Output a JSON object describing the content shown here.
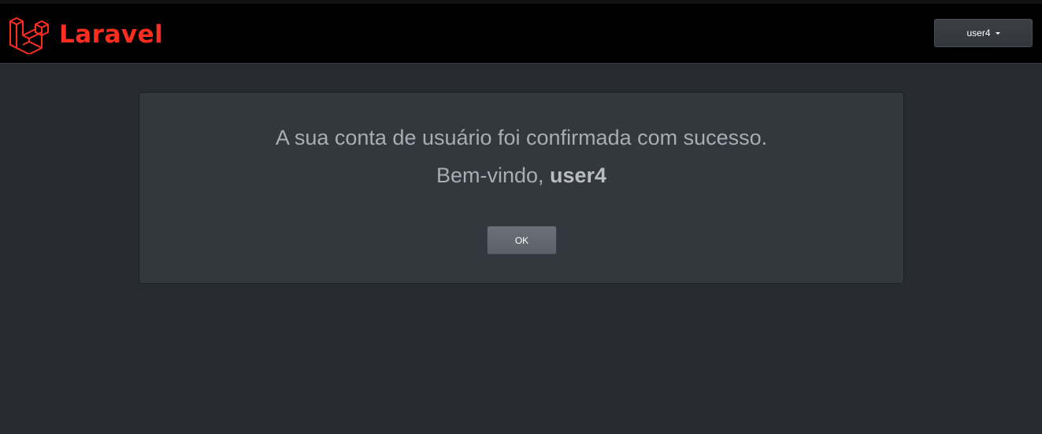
{
  "brand": {
    "name": "Laravel",
    "color": "#ff2d20",
    "logo_icon": "laravel-logo-icon"
  },
  "user_menu": {
    "label": "user4",
    "icon": "caret-down-icon"
  },
  "confirmation": {
    "message": "A sua conta de usuário foi confirmada com sucesso.",
    "welcome_prefix": "Bem-vindo, ",
    "username": "user4",
    "ok_label": "OK"
  }
}
